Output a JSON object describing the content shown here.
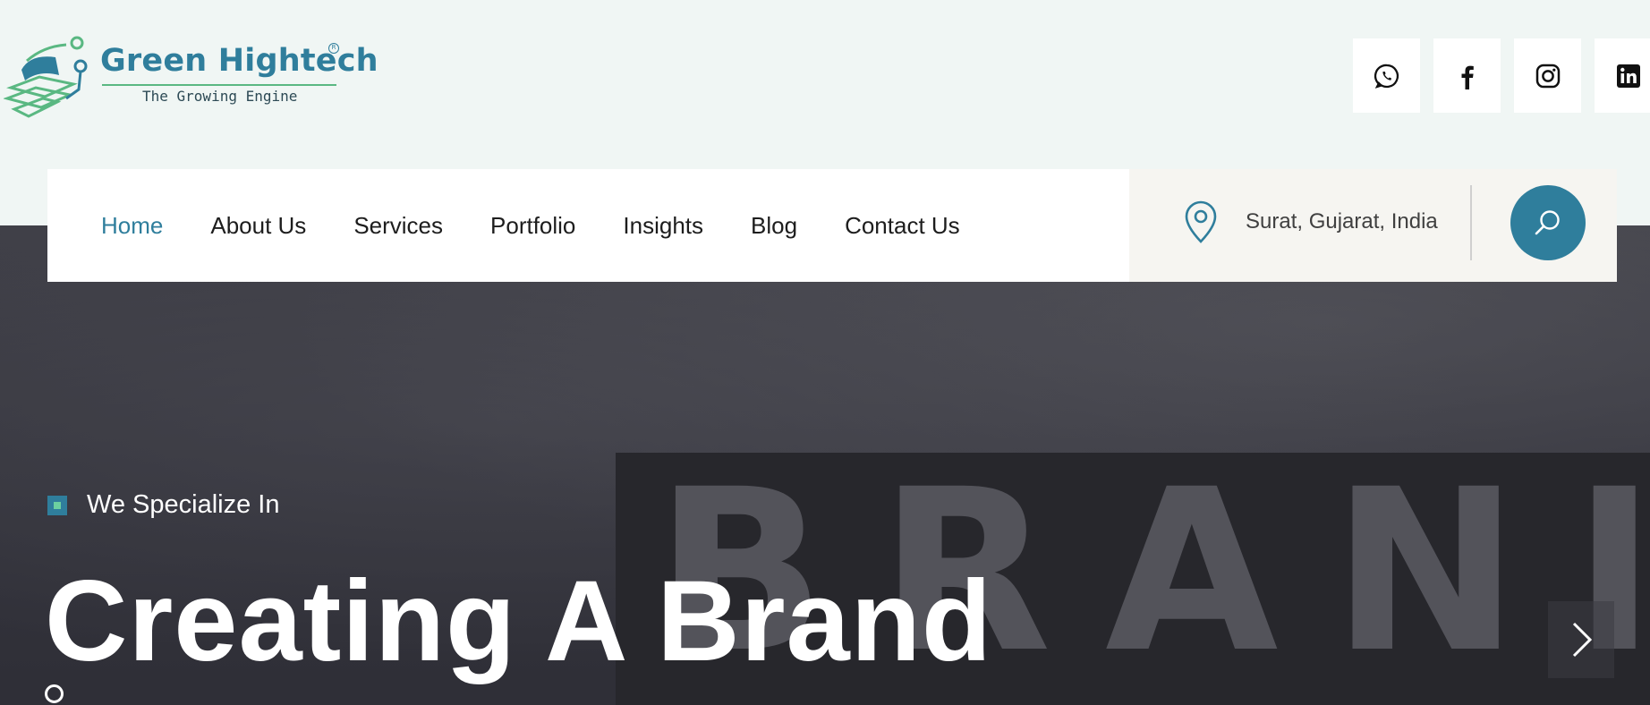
{
  "brand": {
    "name": "Green Hightech",
    "tagline": "The Growing Engine",
    "registered_mark": "R"
  },
  "socials": [
    {
      "icon": "whatsapp-icon"
    },
    {
      "icon": "facebook-icon"
    },
    {
      "icon": "instagram-icon"
    },
    {
      "icon": "linkedin-icon"
    }
  ],
  "nav": {
    "items": [
      {
        "label": "Home",
        "active": true
      },
      {
        "label": "About Us"
      },
      {
        "label": "Services"
      },
      {
        "label": "Portfolio"
      },
      {
        "label": "Insights"
      },
      {
        "label": "Blog"
      },
      {
        "label": "Contact Us"
      }
    ],
    "location": "Surat, Gujarat, India",
    "search_icon": "search-icon",
    "location_icon": "map-pin-icon"
  },
  "hero": {
    "background_text": "BRANI",
    "eyebrow": "We Specialize In",
    "headline": "Creating A Brand",
    "next_icon": "chevron-right-icon"
  },
  "colors": {
    "accent": "#2f7e9c",
    "accent_green": "#5ab882",
    "header_bg": "#f0f6f4"
  }
}
